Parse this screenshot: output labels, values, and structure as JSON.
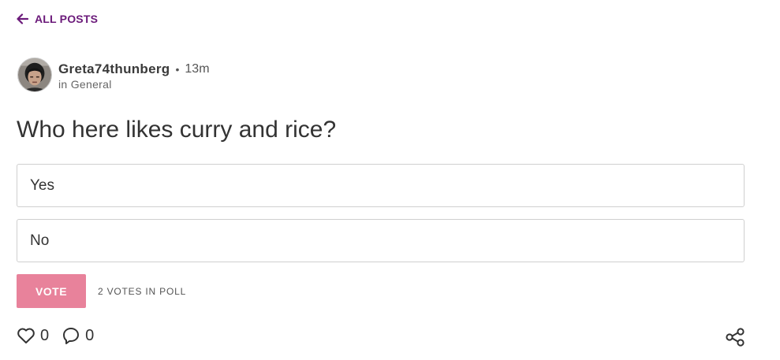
{
  "nav": {
    "back_label": "ALL POSTS",
    "back_icon": "arrow-left-icon",
    "accent": "#6b1a7a"
  },
  "post": {
    "author": "Greta74thunberg",
    "separator": "•",
    "time": "13m",
    "category_prefix": "in",
    "category": "General",
    "question": "Who here likes curry and rice?"
  },
  "poll": {
    "options": [
      {
        "label": "Yes"
      },
      {
        "label": "No"
      }
    ],
    "vote_label": "VOTE",
    "vote_button_color": "#e8829b",
    "votes_text": "2 VOTES IN POLL"
  },
  "stats": {
    "likes": "0",
    "like_icon": "heart-icon",
    "comments": "0",
    "comment_icon": "comment-icon",
    "share_icon": "share-icon"
  }
}
